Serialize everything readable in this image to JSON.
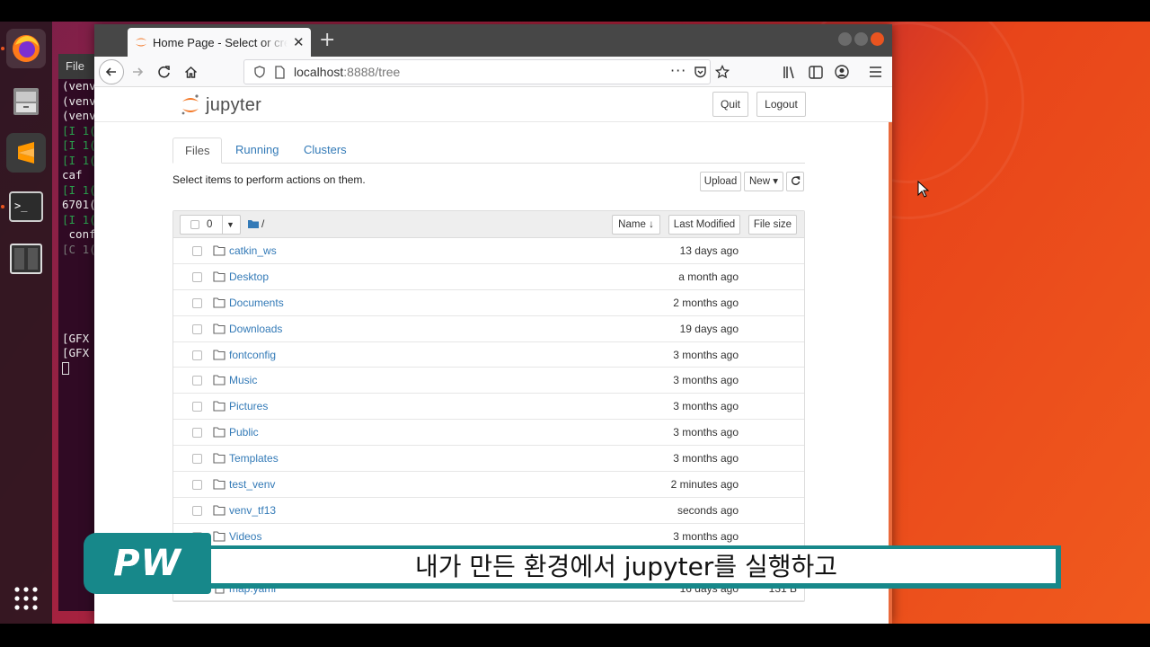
{
  "browser": {
    "tab_title": "Home Page - Select or create a notebook",
    "url_host": "localhost",
    "url_port": ":8888",
    "url_path": "/tree"
  },
  "terminal": {
    "menu": "File",
    "lines": [
      "(venv",
      "(venv",
      "(venv",
      "[I 1(",
      "[I 1(",
      "[I 1(",
      "caf",
      "[I 1(",
      "6701(",
      "[I 1(",
      " conf",
      "[C 1(",
      "",
      "",
      "",
      "",
      "",
      "[GFX",
      "[GFX"
    ]
  },
  "jupyter": {
    "logo_text": "jupyter",
    "quit_label": "Quit",
    "logout_label": "Logout",
    "tabs": [
      "Files",
      "Running",
      "Clusters"
    ],
    "select_hint": "Select items to perform actions on them.",
    "upload_label": "Upload",
    "new_label": "New ▾",
    "selected_count": "0",
    "breadcrumb": "/",
    "col_name": "Name",
    "col_modified": "Last Modified",
    "col_size": "File size",
    "items": [
      {
        "name": "catkin_ws",
        "modified": "13 days ago",
        "size": "",
        "type": "folder"
      },
      {
        "name": "Desktop",
        "modified": "a month ago",
        "size": "",
        "type": "folder"
      },
      {
        "name": "Documents",
        "modified": "2 months ago",
        "size": "",
        "type": "folder"
      },
      {
        "name": "Downloads",
        "modified": "19 days ago",
        "size": "",
        "type": "folder"
      },
      {
        "name": "fontconfig",
        "modified": "3 months ago",
        "size": "",
        "type": "folder"
      },
      {
        "name": "Music",
        "modified": "3 months ago",
        "size": "",
        "type": "folder"
      },
      {
        "name": "Pictures",
        "modified": "3 months ago",
        "size": "",
        "type": "folder"
      },
      {
        "name": "Public",
        "modified": "3 months ago",
        "size": "",
        "type": "folder"
      },
      {
        "name": "Templates",
        "modified": "3 months ago",
        "size": "",
        "type": "folder"
      },
      {
        "name": "test_venv",
        "modified": "2 minutes ago",
        "size": "",
        "type": "folder"
      },
      {
        "name": "venv_tf13",
        "modified": "seconds ago",
        "size": "",
        "type": "folder"
      },
      {
        "name": "Videos",
        "modified": "3 months ago",
        "size": "",
        "type": "folder"
      },
      {
        "name": "",
        "modified": "",
        "size": "",
        "type": "hidden"
      },
      {
        "name": "map.yaml",
        "modified": "16 days ago",
        "size": "131 B",
        "type": "file"
      }
    ]
  },
  "subtitle": {
    "badge": "PW",
    "text": "내가 만든 환경에서 jupyter를 실행하고"
  },
  "colors": {
    "accent": "#e95420",
    "jupyter_orange": "#f37726",
    "link": "#337ab7",
    "subtitle_teal": "#17888a"
  }
}
